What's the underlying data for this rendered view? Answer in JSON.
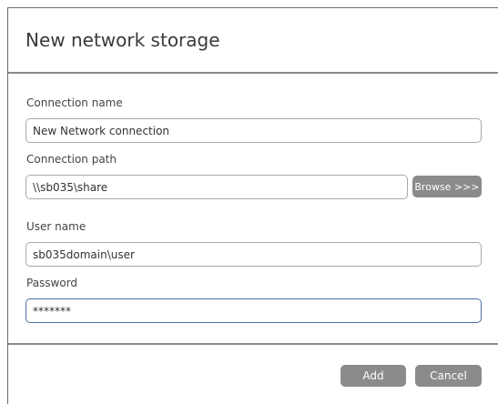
{
  "dialog": {
    "title": "New network storage"
  },
  "form": {
    "connection_name": {
      "label": "Connection name",
      "value": "New Network connection"
    },
    "connection_path": {
      "label": "Connection path",
      "value": "\\\\sb035\\share",
      "browse_label": "Browse >>>"
    },
    "user_name": {
      "label": "User name",
      "value": "sb035domain\\user"
    },
    "password": {
      "label": "Password",
      "value": "*******"
    }
  },
  "footer": {
    "add_label": "Add",
    "cancel_label": "Cancel"
  },
  "colors": {
    "button_gray": "#8b8b8b",
    "focus_border": "#4d6fa3",
    "input_border": "#a8a8a8"
  }
}
